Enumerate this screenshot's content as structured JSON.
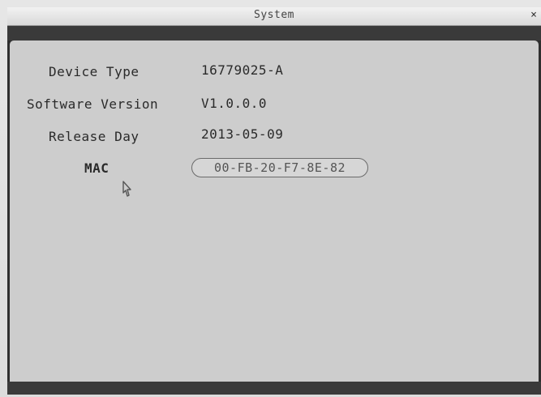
{
  "window": {
    "title": "System",
    "close_glyph": "×"
  },
  "info": {
    "device_type_label": "Device Type",
    "device_type_value": "16779025-A",
    "software_version_label": "Software Version",
    "software_version_value": "V1.0.0.0",
    "release_day_label": "Release Day",
    "release_day_value": "2013-05-09",
    "mac_label": "MAC",
    "mac_value": "00-FB-20-F7-8E-82"
  },
  "icons": {
    "close": "close-icon",
    "cursor": "cursor-icon"
  }
}
